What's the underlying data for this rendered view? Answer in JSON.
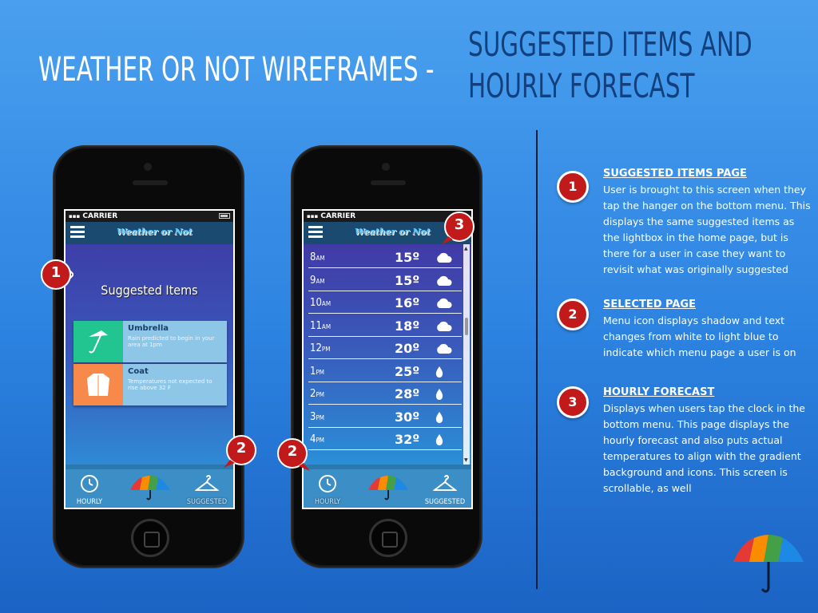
{
  "slide": {
    "title": "WEATHER OR NOT WIREFRAMES -",
    "subtitle_line1": "SUGGESTED ITEMS AND",
    "subtitle_line2": "HOURLY FORECAST"
  },
  "phone_common": {
    "carrier": "CARRIER",
    "app_logo": "Weather or Not",
    "tabs": {
      "hourly": "HOURLY",
      "suggested": "SUGGESTED"
    }
  },
  "suggested_screen": {
    "heading": "Suggested Items",
    "items": [
      {
        "name": "Umbrella",
        "desc": "Rain predicted to begin in your area at 1pm",
        "color": "#22c48f",
        "icon": "umbrella-icon"
      },
      {
        "name": "Coat",
        "desc": "Temperatures not expected to rise above 32 F",
        "color": "#f78a4a",
        "icon": "coat-icon"
      }
    ]
  },
  "hourly_screen": {
    "rows": [
      {
        "hour": "8",
        "ampm": "AM",
        "temp": "15º",
        "icon": "cloud-icon"
      },
      {
        "hour": "9",
        "ampm": "AM",
        "temp": "15º",
        "icon": "cloud-icon"
      },
      {
        "hour": "10",
        "ampm": "AM",
        "temp": "16º",
        "icon": "cloud-icon"
      },
      {
        "hour": "11",
        "ampm": "AM",
        "temp": "18º",
        "icon": "cloud-icon"
      },
      {
        "hour": "12",
        "ampm": "PM",
        "temp": "20º",
        "icon": "cloud-icon"
      },
      {
        "hour": "1",
        "ampm": "PM",
        "temp": "25º",
        "icon": "raindrop-icon"
      },
      {
        "hour": "2",
        "ampm": "PM",
        "temp": "28º",
        "icon": "raindrop-icon"
      },
      {
        "hour": "3",
        "ampm": "PM",
        "temp": "30º",
        "icon": "raindrop-icon"
      },
      {
        "hour": "4",
        "ampm": "PM",
        "temp": "32º",
        "icon": "raindrop-icon"
      }
    ]
  },
  "callouts": {
    "one": "1",
    "two": "2",
    "three": "3"
  },
  "notes": [
    {
      "num": "1",
      "heading": "SUGGESTED ITEMS PAGE",
      "text": "User is brought to this screen when they tap the hanger on the bottom menu. This displays the same suggested items as the lightbox in the home page, but is there for a user in case they want to revisit what was originally suggested"
    },
    {
      "num": "2",
      "heading": "SELECTED PAGE",
      "text": "Menu icon displays shadow and text changes from white to light blue to indicate which menu page a user is on"
    },
    {
      "num": "3",
      "heading": "HOURLY FORECAST",
      "text": "Displays when users tap the clock in the bottom menu. This page displays the hourly forecast and also puts actual temperatures to align with the gradient background and icons. This screen is scrollable, as well"
    }
  ]
}
